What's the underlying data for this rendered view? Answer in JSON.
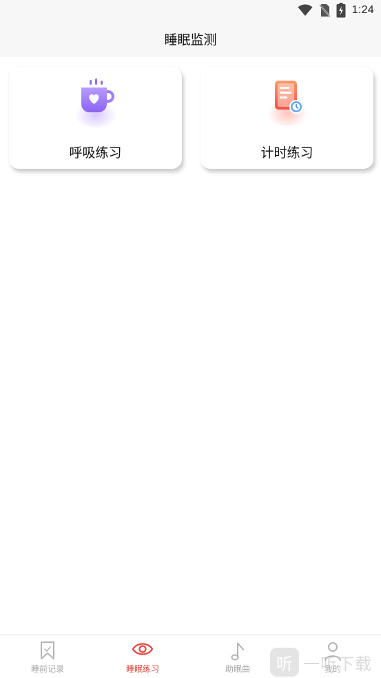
{
  "status_bar": {
    "time": "1:24",
    "icons": [
      "wifi-icon",
      "no-sim-icon",
      "battery-charging-icon"
    ]
  },
  "header": {
    "title": "睡眠监测"
  },
  "cards": [
    {
      "label": "呼吸练习",
      "icon": "coffee-cup-heart-icon"
    },
    {
      "label": "计时练习",
      "icon": "document-clock-icon"
    }
  ],
  "tabs": [
    {
      "label": "睡前记录",
      "icon": "bookmark-icon",
      "active": false
    },
    {
      "label": "睡眠练习",
      "icon": "eye-icon",
      "active": true
    },
    {
      "label": "助眠曲",
      "icon": "music-note-icon",
      "active": false
    },
    {
      "label": "我的",
      "icon": "person-icon",
      "active": false
    }
  ],
  "watermark": {
    "logo_char": "听",
    "text": "一听下载"
  },
  "colors": {
    "accent": "#e6453c",
    "tab_inactive": "#a9a9a9",
    "header_bg": "#f7f7f7"
  }
}
